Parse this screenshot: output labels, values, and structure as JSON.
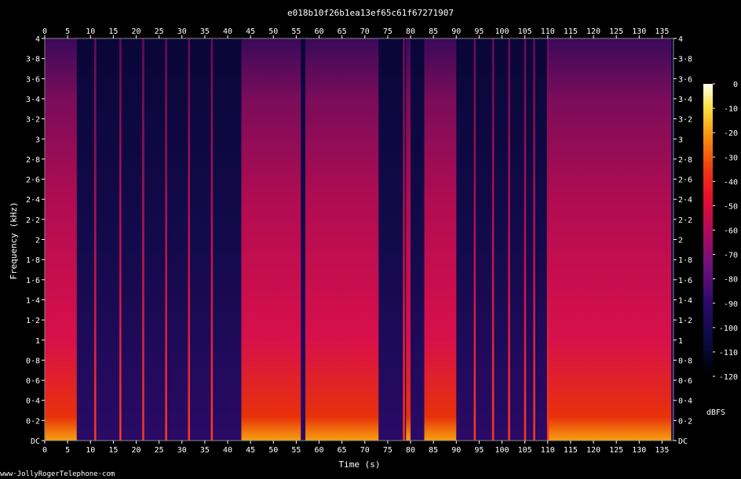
{
  "chart_data": {
    "type": "heatmap",
    "title": "e018b10f26b1ea13ef65c61f67271907",
    "xlabel": "Time (s)",
    "ylabel": "Frequency (kHz)",
    "xlim": [
      0,
      137.5
    ],
    "ylim": [
      0,
      4
    ],
    "x_ticks": [
      "0",
      "5",
      "10",
      "15",
      "20",
      "25",
      "30",
      "35",
      "40",
      "45",
      "50",
      "55",
      "60",
      "65",
      "70",
      "75",
      "80",
      "85",
      "90",
      "95",
      "100",
      "105",
      "110",
      "115",
      "120",
      "125",
      "130",
      "135"
    ],
    "y_ticks": [
      "DC",
      "0·2",
      "0·4",
      "0·6",
      "0·8",
      "1",
      "1·2",
      "1·4",
      "1·6",
      "1·8",
      "2",
      "2·2",
      "2·4",
      "2·6",
      "2·8",
      "3",
      "3·2",
      "3·4",
      "3·6",
      "3·8",
      "4"
    ],
    "colorbar": {
      "label": "dBFS",
      "ticks": [
        "0",
        "-10",
        "-20",
        "-30",
        "-40",
        "-50",
        "-60",
        "-70",
        "-80",
        "-90",
        "-100",
        "-110",
        "-120"
      ],
      "range": [
        -120,
        0
      ]
    },
    "signal_segments_s": [
      [
        0,
        7
      ],
      [
        43,
        56
      ],
      [
        57,
        73
      ],
      [
        79,
        80
      ],
      [
        83,
        90
      ],
      [
        110,
        137
      ]
    ],
    "transient_lines_s": [
      11,
      16.5,
      21.5,
      26.5,
      31.5,
      36.5,
      78.5,
      94,
      98,
      101.5,
      105,
      107,
      110
    ],
    "footer": "www·JollyRogerTelephone·com"
  }
}
